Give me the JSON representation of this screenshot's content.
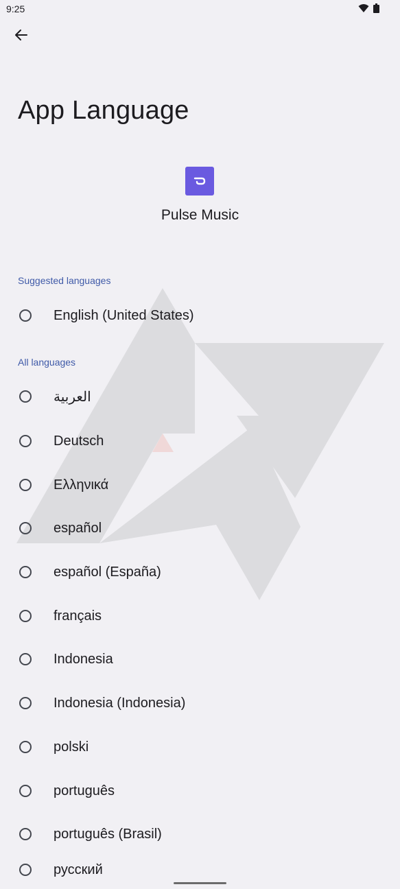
{
  "status": {
    "time": "9:25"
  },
  "page": {
    "title": "App Language"
  },
  "app": {
    "name": "Pulse Music"
  },
  "sections": {
    "suggested": "Suggested languages",
    "all": "All languages"
  },
  "suggested_languages": [
    "English (United States)"
  ],
  "all_languages": [
    "العربية",
    "Deutsch",
    "Ελληνικά",
    "español",
    "español (España)",
    "français",
    "Indonesia",
    "Indonesia (Indonesia)",
    "polski",
    "português",
    "português (Brasil)",
    "русский"
  ],
  "colors": {
    "accent": "#6a5ae0",
    "section_header": "#3f5aa8",
    "background": "#f1f0f4"
  }
}
